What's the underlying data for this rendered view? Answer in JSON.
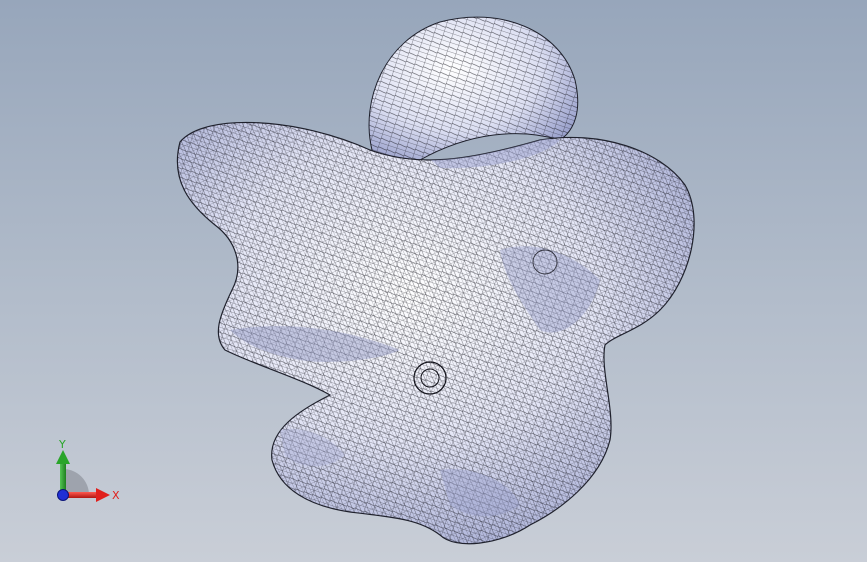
{
  "viewport": {
    "background_top": "#97a6bb",
    "background_bottom": "#c9ced7"
  },
  "model": {
    "fill_color": "#eef0fb",
    "shade_color": "#a9afd6",
    "mesh_color": "#101018",
    "view_style": "shaded-with-edges",
    "icon": "organic-mesh-body"
  },
  "triad": {
    "x_label": "X",
    "y_label": "Y",
    "x_color": "#e0201c",
    "y_color": "#2aa52a",
    "z_color": "#1f2fd6"
  }
}
